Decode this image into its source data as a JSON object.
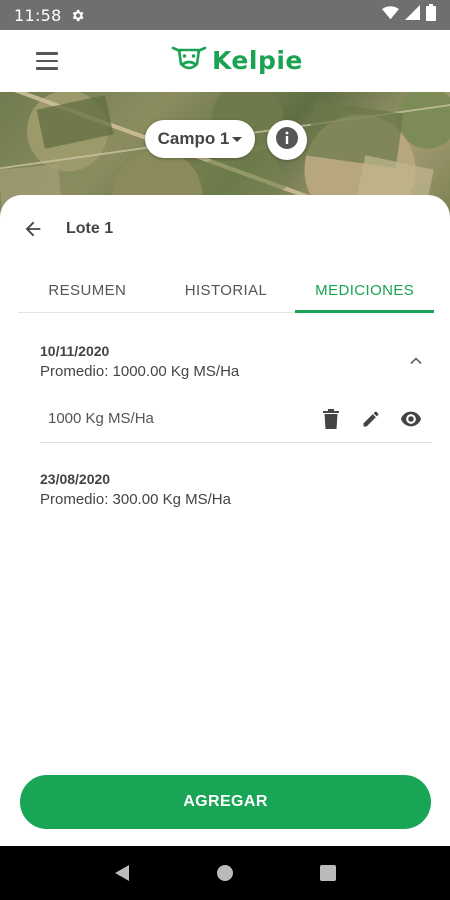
{
  "status_bar": {
    "time": "11:58"
  },
  "app_bar": {
    "logo_text": "Kelpie"
  },
  "map": {
    "field_selector": "Campo 1"
  },
  "sheet": {
    "lot_title": "Lote 1",
    "tabs": [
      {
        "label": "RESUMEN"
      },
      {
        "label": "HISTORIAL"
      },
      {
        "label": "MEDICIONES"
      }
    ],
    "groups": [
      {
        "date": "10/11/2020",
        "average": "Promedio: 1000.00 Kg MS/Ha",
        "expanded": true,
        "measurements": [
          {
            "value": "1000 Kg MS/Ha"
          }
        ]
      },
      {
        "date": "23/08/2020",
        "average": "Promedio: 300.00 Kg MS/Ha",
        "expanded": false,
        "measurements": []
      }
    ],
    "add_button": "AGREGAR"
  },
  "colors": {
    "accent": "#1aa352",
    "status_bar": "#6f6f6f",
    "nav_bar": "#000000"
  },
  "icons": [
    "gear-icon",
    "wifi-icon",
    "signal-icon",
    "battery-icon",
    "menu-icon",
    "cow-logo-icon",
    "caret-down-icon",
    "info-icon",
    "back-arrow-icon",
    "chevron-up-icon",
    "trash-icon",
    "pencil-icon",
    "eye-icon",
    "nav-back-icon",
    "nav-home-icon",
    "nav-recents-icon"
  ]
}
